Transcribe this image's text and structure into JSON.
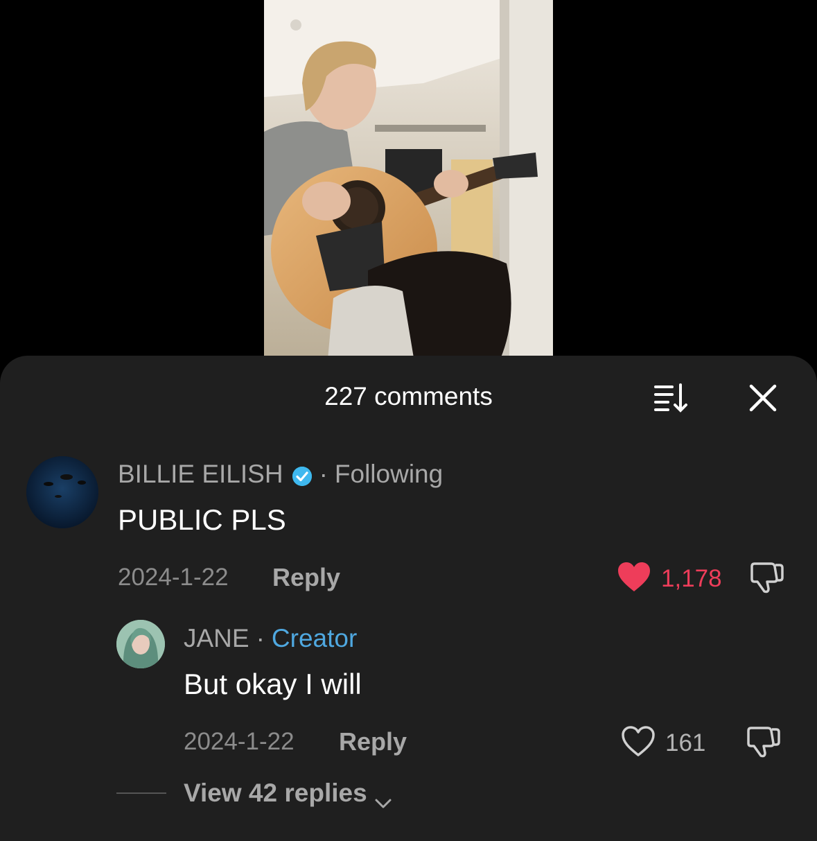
{
  "comments_panel": {
    "title": "227 comments",
    "sort_icon": "sort-icon",
    "close_icon": "close-icon"
  },
  "comments": [
    {
      "username": "BILLIE EILISH",
      "verified": true,
      "separator": "·",
      "tag": "Following",
      "text": "PUBLIC PLS",
      "date": "2024-1-22",
      "reply_label": "Reply",
      "likes": "1,178",
      "liked": true,
      "like_color": "#ee3d5a"
    }
  ],
  "replies": [
    {
      "username": "JANE",
      "separator": "·",
      "tag": "Creator",
      "tag_color": "#4fa8e0",
      "text": "But okay I will",
      "date": "2024-1-22",
      "reply_label": "Reply",
      "likes": "161",
      "liked": false
    }
  ],
  "view_replies_label": "View 42 replies"
}
